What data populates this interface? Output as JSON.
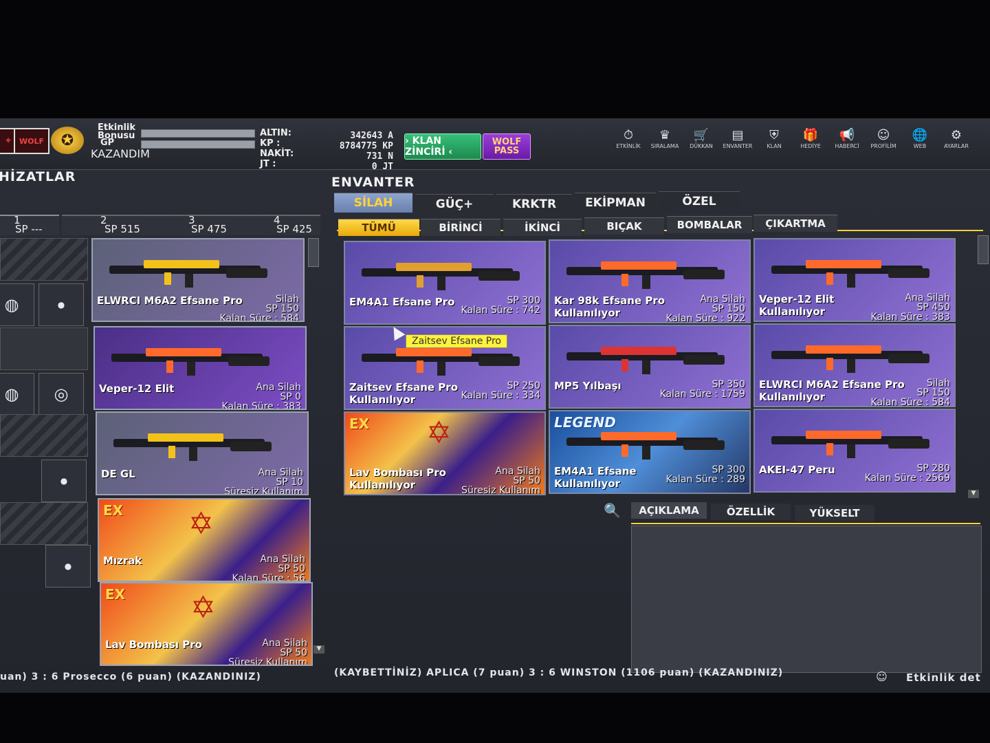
{
  "header": {
    "bonus_label": "Etkinlik\nBonusu",
    "gp_label": "GP",
    "kazandim": "KAZANDIM",
    "currencies": [
      {
        "label": "ALTIN:",
        "value": "342643",
        "unit": "A"
      },
      {
        "label": "KP :",
        "value": "8784775",
        "unit": "KP"
      },
      {
        "label": "NAKİT:",
        "value": "731",
        "unit": "N"
      },
      {
        "label": "JT :",
        "value": "0",
        "unit": "JT"
      }
    ],
    "klan_btn": "› KLAN ZİNCİRİ ‹",
    "wolf_btn": "WOLF PASS"
  },
  "nav": [
    {
      "label": "ETKİNLİK",
      "icon": "stopwatch-icon",
      "glyph": "⏱"
    },
    {
      "label": "SIRALAMA",
      "icon": "wolf-icon",
      "glyph": "♛"
    },
    {
      "label": "DÜKKAN",
      "icon": "cart-icon",
      "glyph": "🛒"
    },
    {
      "label": "ENVANTER",
      "icon": "inventory-icon",
      "glyph": "▤"
    },
    {
      "label": "KLAN",
      "icon": "shield-icon",
      "glyph": "⛨"
    },
    {
      "label": "HEDİYE",
      "icon": "gift-icon",
      "glyph": "🎁"
    },
    {
      "label": "HABERCİ",
      "icon": "megaphone-icon",
      "glyph": "📢"
    },
    {
      "label": "PROFİLİM",
      "icon": "profile-icon",
      "glyph": "☺"
    },
    {
      "label": "WEB",
      "icon": "globe-icon",
      "glyph": "🌐"
    },
    {
      "label": "AYARLAR",
      "icon": "gear-icon",
      "glyph": "⚙"
    }
  ],
  "left": {
    "title": "HİZATLAR",
    "slots": [
      {
        "num": "1",
        "sp": "SP ---"
      },
      {
        "num": "2",
        "sp": "SP 515"
      },
      {
        "num": "3",
        "sp": "SP 475"
      },
      {
        "num": "4",
        "sp": "SP 425"
      }
    ],
    "cards": [
      {
        "name": "ELWRCI M6A2 Efsane Pro",
        "type": "Silah",
        "sp": "SP 150",
        "time": "Kalan Süre : 584",
        "style": "steel",
        "ex": ""
      },
      {
        "name": "Veper-12 Elit",
        "type": "Ana Silah",
        "sp": "SP 0",
        "time": "Kalan Süre : 383",
        "style": "purple",
        "ex": ""
      },
      {
        "name": "DE GL",
        "type": "Ana Silah",
        "sp": "SP 10",
        "time": "Süresiz Kullanım",
        "style": "steel",
        "ex": ""
      },
      {
        "name": "Mızrak",
        "type": "Ana Silah",
        "sp": "SP 50",
        "time": "Kalan Süre : 56",
        "style": "fire",
        "ex": "EX"
      },
      {
        "name": "Lav Bombası Pro",
        "type": "Ana Silah",
        "sp": "SP 50",
        "time": "Süresiz Kullanım",
        "style": "fire",
        "ex": "EX"
      }
    ]
  },
  "inventory": {
    "title": "ENVANTER",
    "tabs": [
      "SİLAH",
      "GÜÇ+",
      "KRKTR",
      "EKİPMAN",
      "ÖZEL"
    ],
    "subtabs": [
      "TÜMÜ",
      "BİRİNCİ",
      "İKİNCİ",
      "BIÇAK",
      "BOMBALAR",
      "ÇIKARTMA"
    ],
    "tooltip": "Zaitsev Efsane Pro",
    "items": [
      {
        "name": "EM4A1 Efsane Pro",
        "type": "",
        "sp": "SP 300",
        "time": "Kalan Süre : 742",
        "used": "",
        "style": "purple",
        "ex": ""
      },
      {
        "name": "Kar 98k Efsane Pro",
        "type": "Ana Silah",
        "sp": "SP 150",
        "time": "Kalan Süre : 922",
        "used": "Kullanılıyor",
        "style": "purple",
        "ex": ""
      },
      {
        "name": "Veper-12 Elit",
        "type": "Ana Silah",
        "sp": "SP 450",
        "time": "Kalan Süre : 383",
        "used": "Kullanılıyor",
        "style": "purple",
        "ex": ""
      },
      {
        "name": "Zaitsev Efsane Pro",
        "type": "",
        "sp": "SP 250",
        "time": "Kalan Süre : 334",
        "used": "Kullanılıyor",
        "style": "purple",
        "ex": ""
      },
      {
        "name": "MP5 Yılbaşı",
        "type": "",
        "sp": "SP 350",
        "time": "Kalan Süre : 1759",
        "used": "",
        "style": "purple",
        "ex": ""
      },
      {
        "name": "ELWRCI M6A2 Efsane Pro",
        "type": "Silah",
        "sp": "SP 150",
        "time": "Kalan Süre : 584",
        "used": "Kullanılıyor",
        "style": "purple",
        "ex": ""
      },
      {
        "name": "Lav Bombası Pro",
        "type": "Ana Silah",
        "sp": "SP 50",
        "time": "Süresiz Kullanım",
        "used": "Kullanılıyor",
        "style": "fire",
        "ex": "EX"
      },
      {
        "name": "EM4A1 Efsane",
        "type": "",
        "sp": "SP 300",
        "time": "Kalan Süre : 289",
        "used": "Kullanılıyor",
        "style": "blue",
        "ex": "LEGEND"
      },
      {
        "name": "AKEI-47 Peru",
        "type": "",
        "sp": "SP 280",
        "time": "Kalan Süre : 2569",
        "used": "",
        "style": "purple",
        "ex": ""
      }
    ],
    "detail_tabs": [
      "AÇIKLAMA",
      "ÖZELLİK",
      "YÜKSELT"
    ]
  },
  "ticker": {
    "left": "uan) 3 : 6 Prosecco (6 puan) (KAZANDINIZ)",
    "middle": "(KAYBETTİNİZ) APLICA (7 puan) 3 : 6 WINSTON (1106 puan) (KAZANDINIZ)",
    "right": "Etkinlik det"
  },
  "colors": {
    "accent": "#ffd23a",
    "klan": "#1b8a4d",
    "wolf": "#6a1aa8"
  }
}
